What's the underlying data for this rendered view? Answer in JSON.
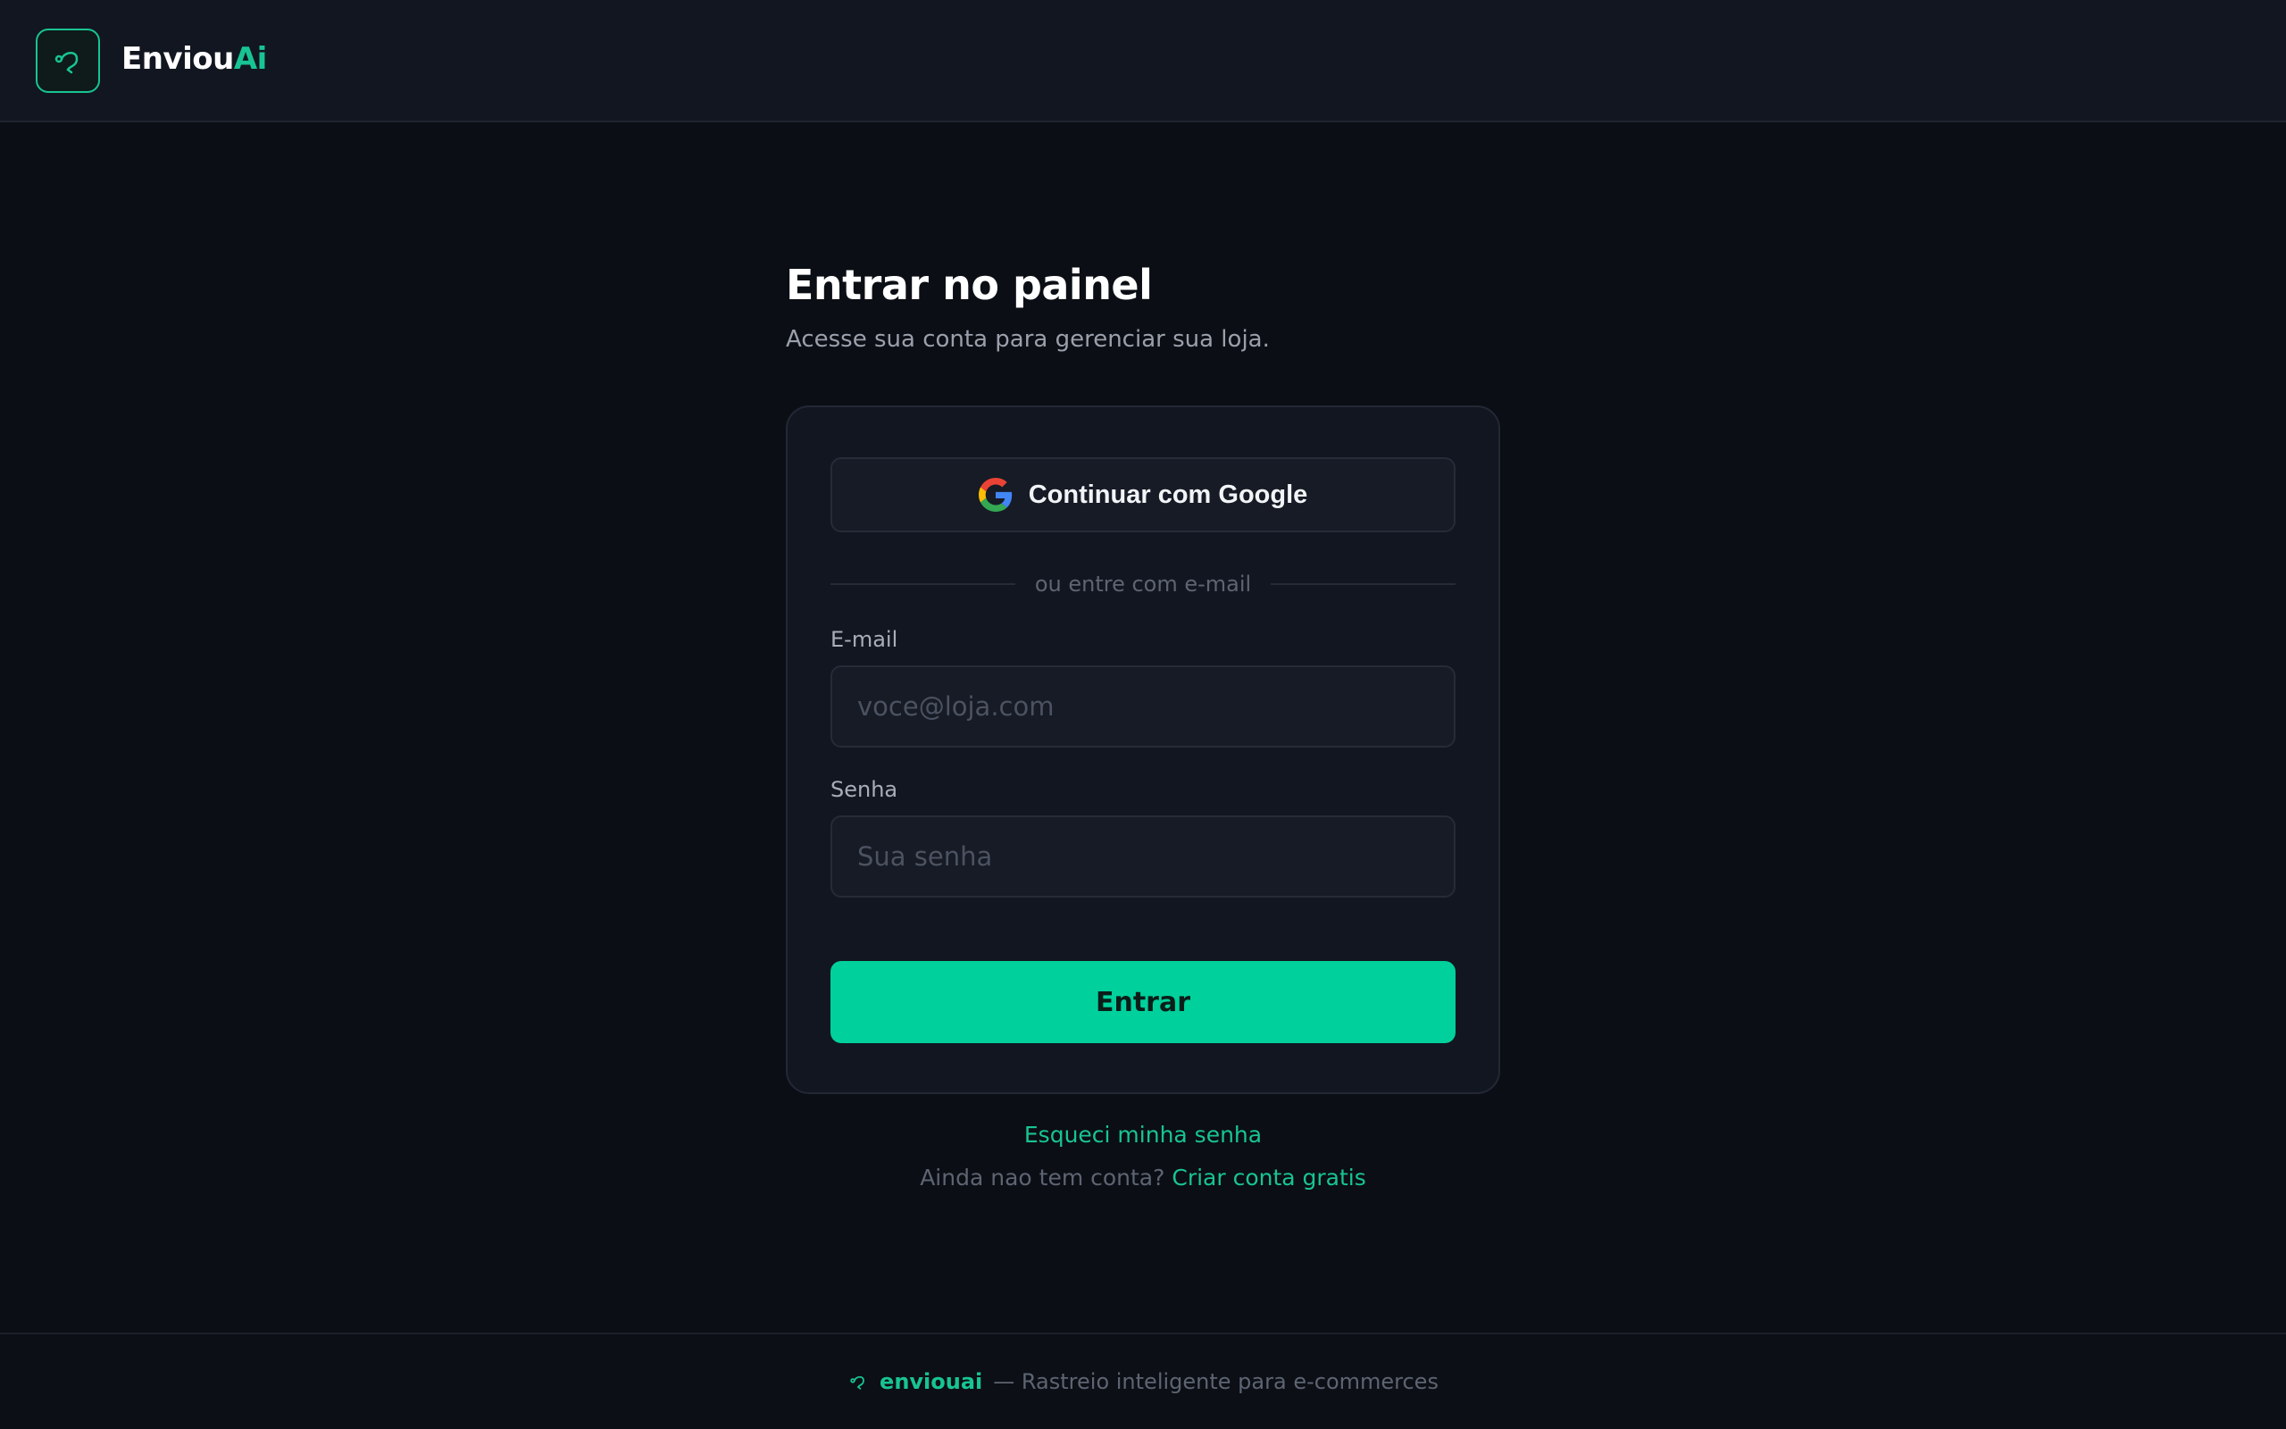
{
  "header": {
    "brand_main": "Enviou",
    "brand_accent": "Ai",
    "logo_icon": "route-icon"
  },
  "page": {
    "title": "Entrar no painel",
    "subtitle": "Acesse sua conta para gerenciar sua loja."
  },
  "form": {
    "google_label": "Continuar com Google",
    "google_icon": "google-icon",
    "divider_text": "ou entre com e-mail",
    "email_label": "E-mail",
    "email_placeholder": "voce@loja.com",
    "email_value": "",
    "password_label": "Senha",
    "password_placeholder": "Sua senha",
    "password_value": "",
    "submit_label": "Entrar"
  },
  "links": {
    "forgot": "Esqueci minha senha",
    "no_account": "Ainda nao tem conta?",
    "signup": "Criar conta gratis"
  },
  "footer": {
    "brand": "enviouai",
    "tagline": "— Rastreio inteligente para e-commerces"
  },
  "colors": {
    "accent": "#18c493",
    "button": "#00d09c",
    "background": "#0b0e14",
    "card": "#121620"
  }
}
